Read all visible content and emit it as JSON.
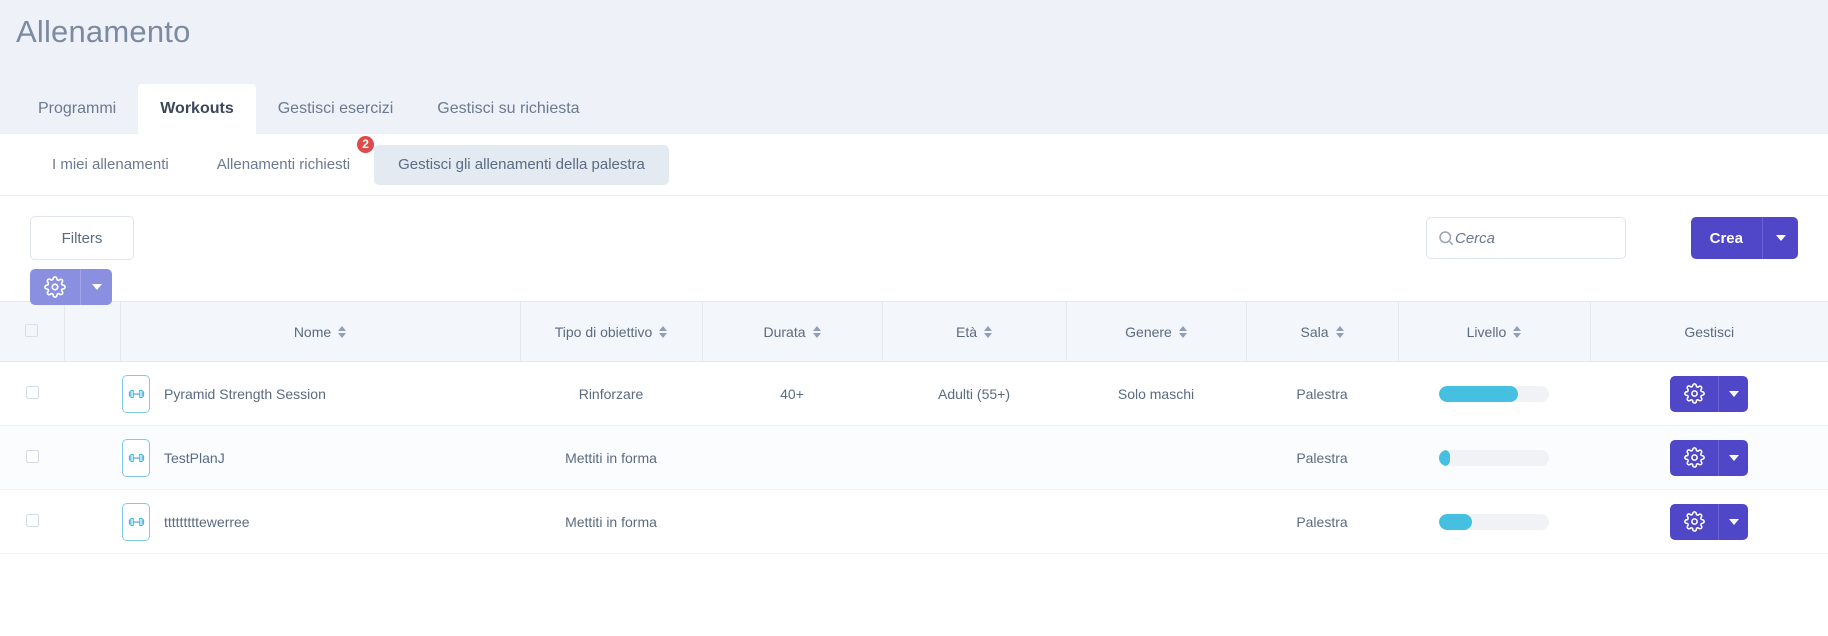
{
  "page": {
    "title": "Allenamento"
  },
  "tabs": [
    {
      "label": "Programmi",
      "active": false
    },
    {
      "label": "Workouts",
      "active": true
    },
    {
      "label": "Gestisci esercizi",
      "active": false
    },
    {
      "label": "Gestisci su richiesta",
      "active": false
    }
  ],
  "subtabs": [
    {
      "label": "I miei allenamenti",
      "active": false,
      "badge": ""
    },
    {
      "label": "Allenamenti richiesti",
      "active": false,
      "badge": "2"
    },
    {
      "label": "Gestisci gli allenamenti della palestra",
      "active": true,
      "badge": ""
    }
  ],
  "toolbar": {
    "filters_label": "Filters",
    "search_placeholder": "Cerca",
    "search_value": "",
    "search_icon": "search-icon",
    "create_label": "Crea",
    "settings_icon": "gear-icon",
    "caret_icon": "chevron-down-icon"
  },
  "table": {
    "columns": [
      {
        "label": "",
        "sortable": false
      },
      {
        "label": "",
        "sortable": false
      },
      {
        "label": "Nome",
        "sortable": true
      },
      {
        "label": "Tipo di obiettivo",
        "sortable": true
      },
      {
        "label": "Durata",
        "sortable": true
      },
      {
        "label": "Età",
        "sortable": true
      },
      {
        "label": "Genere",
        "sortable": true
      },
      {
        "label": "Sala",
        "sortable": true
      },
      {
        "label": "Livello",
        "sortable": true
      },
      {
        "label": "Gestisci",
        "sortable": false
      }
    ],
    "rows": [
      {
        "name": "Pyramid Strength Session",
        "goal": "Rinforzare",
        "duration": "40+",
        "age": "Adulti (55+)",
        "gender": "Solo maschi",
        "room": "Palestra",
        "level_percent": 72,
        "icon": "dumbbell-icon"
      },
      {
        "name": "TestPlanJ",
        "goal": "Mettiti in forma",
        "duration": "",
        "age": "",
        "gender": "",
        "room": "Palestra",
        "level_percent": 10,
        "icon": "dumbbell-icon"
      },
      {
        "name": "tttttttttewerree",
        "goal": "Mettiti in forma",
        "duration": "",
        "age": "",
        "gender": "",
        "room": "Palestra",
        "level_percent": 30,
        "icon": "dumbbell-icon"
      }
    ]
  },
  "colors": {
    "accent_purple": "#5046c8",
    "accent_purple_light": "#8b8fe0",
    "progress_cyan": "#45c0e0",
    "badge_red": "#dd4b4b",
    "icon_blue": "#7ecbe8",
    "page_bg": "#eef1f8"
  }
}
